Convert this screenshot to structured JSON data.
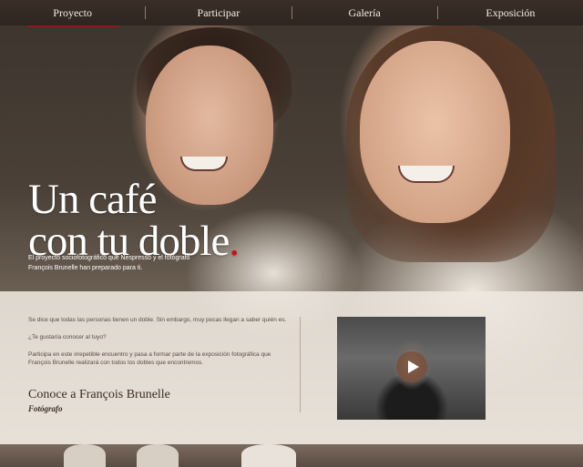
{
  "nav": {
    "items": [
      {
        "label": "Proyecto",
        "active": true
      },
      {
        "label": "Participar",
        "active": false
      },
      {
        "label": "Galería",
        "active": false
      },
      {
        "label": "Exposición",
        "active": false
      }
    ]
  },
  "hero": {
    "title_line1": "Un café",
    "title_line2": "con tu doble",
    "title_dot": ".",
    "subtitle": "El proyecto sociofotográfico que Nespresso y el fotógrafo François Brunelle han preparado para ti."
  },
  "intro": {
    "paragraph1": "Se dice que todas las personas tienen un doble. Sin embargo, muy pocas llegan a saber quién es.",
    "paragraph2": "¿Te gustaría conocer al tuyo?",
    "paragraph3": "Participa en este irrepetible encuentro y pasa a formar parte de la exposición fotográfica que François Brunelle realizará con todos los dobles que encontremos."
  },
  "photographer": {
    "heading": "Conoce a François Brunelle",
    "role": "Fotógrafo"
  },
  "video": {
    "play_icon": "play-icon"
  },
  "colors": {
    "accent": "#c3121c",
    "nav_bg": "#2e2520",
    "panel_bg": "#eee8e0"
  }
}
